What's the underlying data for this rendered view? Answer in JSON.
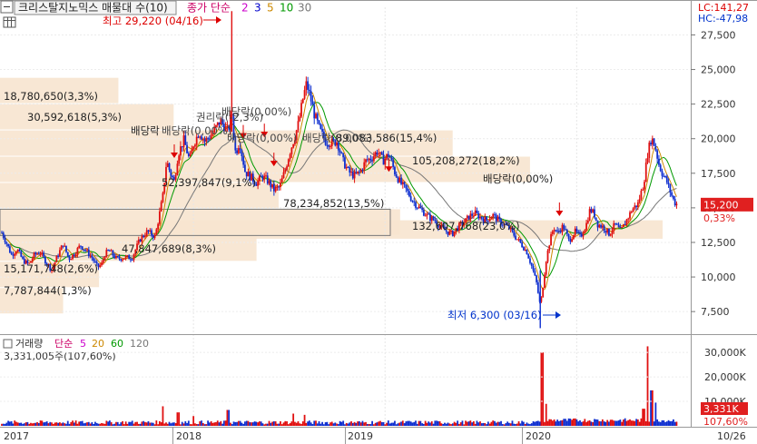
{
  "header": {
    "box_label": "크리스탈지노믹스 매물대 수(10)",
    "ma_label": "종가 단순",
    "ma_periods": [
      "2",
      "3",
      "5",
      "10",
      "30"
    ],
    "ma_colors": [
      "#cc00cc",
      "#0000cc",
      "#cc8800",
      "#009900",
      "#777777"
    ],
    "lc_text": "LC:141,27",
    "hc_text": "HC:-47,98"
  },
  "price_axis": {
    "ticks": [
      "27,500",
      "25,000",
      "22,500",
      "20,000",
      "17,500",
      "15,000",
      "12,500",
      "10,000",
      "7,500"
    ],
    "tick_values": [
      27500,
      25000,
      22500,
      20000,
      17500,
      15000,
      12500,
      10000,
      7500
    ],
    "current_price": "15,200",
    "current_change": "0,33%",
    "current_value": 15200
  },
  "volume_panel": {
    "title": "거래량",
    "ma_label": "단순",
    "ma_periods": [
      "5",
      "20",
      "60",
      "120"
    ],
    "ma_colors": [
      "#cc00cc",
      "#cc8800",
      "#009900",
      "#777777"
    ],
    "current_volume": "3,331,005주(107,60%)",
    "ticks": [
      "30,000K",
      "20,000K",
      "10,000K"
    ],
    "tick_values": [
      30000,
      20000,
      10000
    ],
    "badge_value": "3,331K",
    "badge_pct": "107,60%"
  },
  "date_axis": {
    "labels": [
      "2017",
      "2018",
      "2019",
      "2020"
    ],
    "last_label": "10/26"
  },
  "annotations": {
    "high": "최고 29,220 (04/16)",
    "low": "최저 6,300 (03/16)",
    "dividend": "배당락",
    "dividend_right": "배당락(0,00%)",
    "dividend_left": "배당락(0,00%)",
    "cluttered_a": "권리락(-2,3%)",
    "cluttered_b": "배당락(0,00%)",
    "cluttered_c": "배당락(0,00%)",
    "cluttered_d": "배당락(0,00%)"
  },
  "chart_data": {
    "type": "candlestick",
    "y_unit": "KRW",
    "ylim": [
      6000,
      29500
    ],
    "volume_ylim": [
      0,
      36000
    ],
    "high": {
      "value": 29220,
      "date": "04/16"
    },
    "low": {
      "value": 6300,
      "date": "03/16"
    },
    "volume_profile": [
      {
        "label": "18,780,650(3,3%)",
        "price_low": 22500,
        "price_high": 24400,
        "share_pct": 3.3
      },
      {
        "label": "30,592,618(5,3%)",
        "price_low": 20600,
        "price_high": 22500,
        "share_pct": 5.3
      },
      {
        "label": "89,083,586(15,4%)",
        "price_low": 18700,
        "price_high": 20600,
        "share_pct": 15.4
      },
      {
        "label": "105,208,272(18,2%)",
        "price_low": 16800,
        "price_high": 18700,
        "share_pct": 18.2
      },
      {
        "label": "52,397,847(9,1%)",
        "price_low": 14900,
        "price_high": 16800,
        "share_pct": 9.1
      },
      {
        "label": "78,234,852(13,5%)",
        "price_low": 13000,
        "price_high": 14900,
        "share_pct": 13.5
      },
      {
        "label": "132,607,768(23,0%)",
        "price_low": 12700,
        "price_high": 14100,
        "share_pct": 23.0
      },
      {
        "label": "47,847,689(8,3%)",
        "price_low": 11100,
        "price_high": 13000,
        "share_pct": 8.3
      },
      {
        "label": "15,171,748(2,6%)",
        "price_low": 9200,
        "price_high": 11100,
        "share_pct": 2.6
      },
      {
        "label": "7,787,844(1,3%)",
        "price_low": 7300,
        "price_high": 9200,
        "share_pct": 1.3
      }
    ],
    "price_path": [
      [
        0,
        13200
      ],
      [
        0.02,
        12600
      ],
      [
        0.05,
        11600
      ],
      [
        0.08,
        12000
      ],
      [
        0.11,
        11200
      ],
      [
        0.14,
        10900
      ],
      [
        0.17,
        11600
      ],
      [
        0.2,
        11800
      ],
      [
        0.23,
        11100
      ],
      [
        0.26,
        10500
      ],
      [
        0.29,
        11500
      ],
      [
        0.32,
        12400
      ],
      [
        0.35,
        11300
      ],
      [
        0.38,
        11700
      ],
      [
        0.41,
        12300
      ],
      [
        0.44,
        11900
      ],
      [
        0.47,
        11400
      ],
      [
        0.5,
        10700
      ],
      [
        0.52,
        10900
      ],
      [
        0.54,
        11700
      ],
      [
        0.56,
        11900
      ],
      [
        0.6,
        11300
      ],
      [
        0.64,
        11400
      ],
      [
        0.68,
        11400
      ],
      [
        0.72,
        12700
      ],
      [
        0.76,
        13300
      ],
      [
        0.8,
        12900
      ],
      [
        0.84,
        15800
      ],
      [
        0.86,
        18400
      ],
      [
        0.88,
        17500
      ],
      [
        0.9,
        16900
      ],
      [
        0.92,
        18900
      ],
      [
        0.95,
        19900
      ],
      [
        0.98,
        18400
      ],
      [
        1.0,
        19600
      ],
      [
        1.03,
        20500
      ],
      [
        1.06,
        19800
      ],
      [
        1.1,
        20400
      ],
      [
        1.14,
        21300
      ],
      [
        1.16,
        20900
      ],
      [
        1.18,
        20500
      ],
      [
        1.2,
        21900
      ],
      [
        1.22,
        18900
      ],
      [
        1.24,
        19800
      ],
      [
        1.27,
        17600
      ],
      [
        1.3,
        17200
      ],
      [
        1.33,
        16800
      ],
      [
        1.36,
        17300
      ],
      [
        1.39,
        16900
      ],
      [
        1.42,
        16300
      ],
      [
        1.45,
        16500
      ],
      [
        1.48,
        17800
      ],
      [
        1.5,
        18900
      ],
      [
        1.53,
        20200
      ],
      [
        1.55,
        21200
      ],
      [
        1.57,
        22800
      ],
      [
        1.59,
        24000
      ],
      [
        1.61,
        23000
      ],
      [
        1.63,
        21800
      ],
      [
        1.66,
        20600
      ],
      [
        1.69,
        19800
      ],
      [
        1.72,
        19700
      ],
      [
        1.75,
        19800
      ],
      [
        1.78,
        18400
      ],
      [
        1.81,
        17600
      ],
      [
        1.84,
        17300
      ],
      [
        1.87,
        17600
      ],
      [
        1.9,
        18400
      ],
      [
        1.93,
        18600
      ],
      [
        1.96,
        19100
      ],
      [
        1.99,
        18400
      ],
      [
        2.02,
        18900
      ],
      [
        2.05,
        17600
      ],
      [
        2.08,
        16800
      ],
      [
        2.11,
        16300
      ],
      [
        2.14,
        15600
      ],
      [
        2.17,
        15100
      ],
      [
        2.2,
        14700
      ],
      [
        2.23,
        14300
      ],
      [
        2.26,
        14100
      ],
      [
        2.29,
        13600
      ],
      [
        2.32,
        13300
      ],
      [
        2.35,
        13100
      ],
      [
        2.38,
        13600
      ],
      [
        2.41,
        13900
      ],
      [
        2.44,
        14400
      ],
      [
        2.47,
        14600
      ],
      [
        2.5,
        14300
      ],
      [
        2.53,
        14100
      ],
      [
        2.56,
        14500
      ],
      [
        2.59,
        14100
      ],
      [
        2.62,
        13800
      ],
      [
        2.65,
        13500
      ],
      [
        2.68,
        12900
      ],
      [
        2.71,
        12400
      ],
      [
        2.74,
        11800
      ],
      [
        2.77,
        10600
      ],
      [
        2.79,
        9600
      ],
      [
        2.81,
        7900
      ],
      [
        2.82,
        8900
      ],
      [
        2.84,
        11200
      ],
      [
        2.86,
        12600
      ],
      [
        2.88,
        13600
      ],
      [
        2.9,
        13200
      ],
      [
        2.93,
        13700
      ],
      [
        2.96,
        12600
      ],
      [
        2.99,
        13300
      ],
      [
        3.02,
        12900
      ],
      [
        3.05,
        13800
      ],
      [
        3.07,
        14900
      ],
      [
        3.09,
        14600
      ],
      [
        3.11,
        13800
      ],
      [
        3.14,
        13600
      ],
      [
        3.17,
        13100
      ],
      [
        3.2,
        13800
      ],
      [
        3.23,
        13300
      ],
      [
        3.26,
        14100
      ],
      [
        3.29,
        14900
      ],
      [
        3.32,
        15300
      ],
      [
        3.35,
        16800
      ],
      [
        3.37,
        18900
      ],
      [
        3.39,
        20100
      ],
      [
        3.41,
        19400
      ],
      [
        3.43,
        18100
      ],
      [
        3.45,
        17400
      ],
      [
        3.47,
        16900
      ],
      [
        3.49,
        16100
      ],
      [
        3.51,
        15400
      ],
      [
        3.53,
        15200
      ]
    ],
    "volume_spikes": [
      {
        "t": 0.84,
        "v": 8000
      },
      {
        "t": 0.92,
        "v": 5500
      },
      {
        "t": 1.0,
        "v": 4000
      },
      {
        "t": 1.18,
        "v": 6500
      },
      {
        "t": 1.52,
        "v": 5000
      },
      {
        "t": 1.58,
        "v": 4500
      },
      {
        "t": 2.82,
        "v": 30000
      },
      {
        "t": 2.84,
        "v": 9000
      },
      {
        "t": 3.37,
        "v": 32500
      },
      {
        "t": 3.39,
        "v": 14500
      },
      {
        "t": 3.41,
        "v": 9500
      },
      {
        "t": 3.35,
        "v": 7000
      }
    ],
    "dividend_marks": [
      {
        "t": 0.9,
        "price": 18800
      },
      {
        "t": 1.26,
        "price": 20200
      },
      {
        "t": 1.37,
        "price": 20300
      },
      {
        "t": 1.42,
        "price": 18200
      },
      {
        "t": 2.02,
        "price": 17800
      },
      {
        "t": 2.91,
        "price": 14600
      }
    ],
    "legend_position": "top-left",
    "grid": true
  }
}
